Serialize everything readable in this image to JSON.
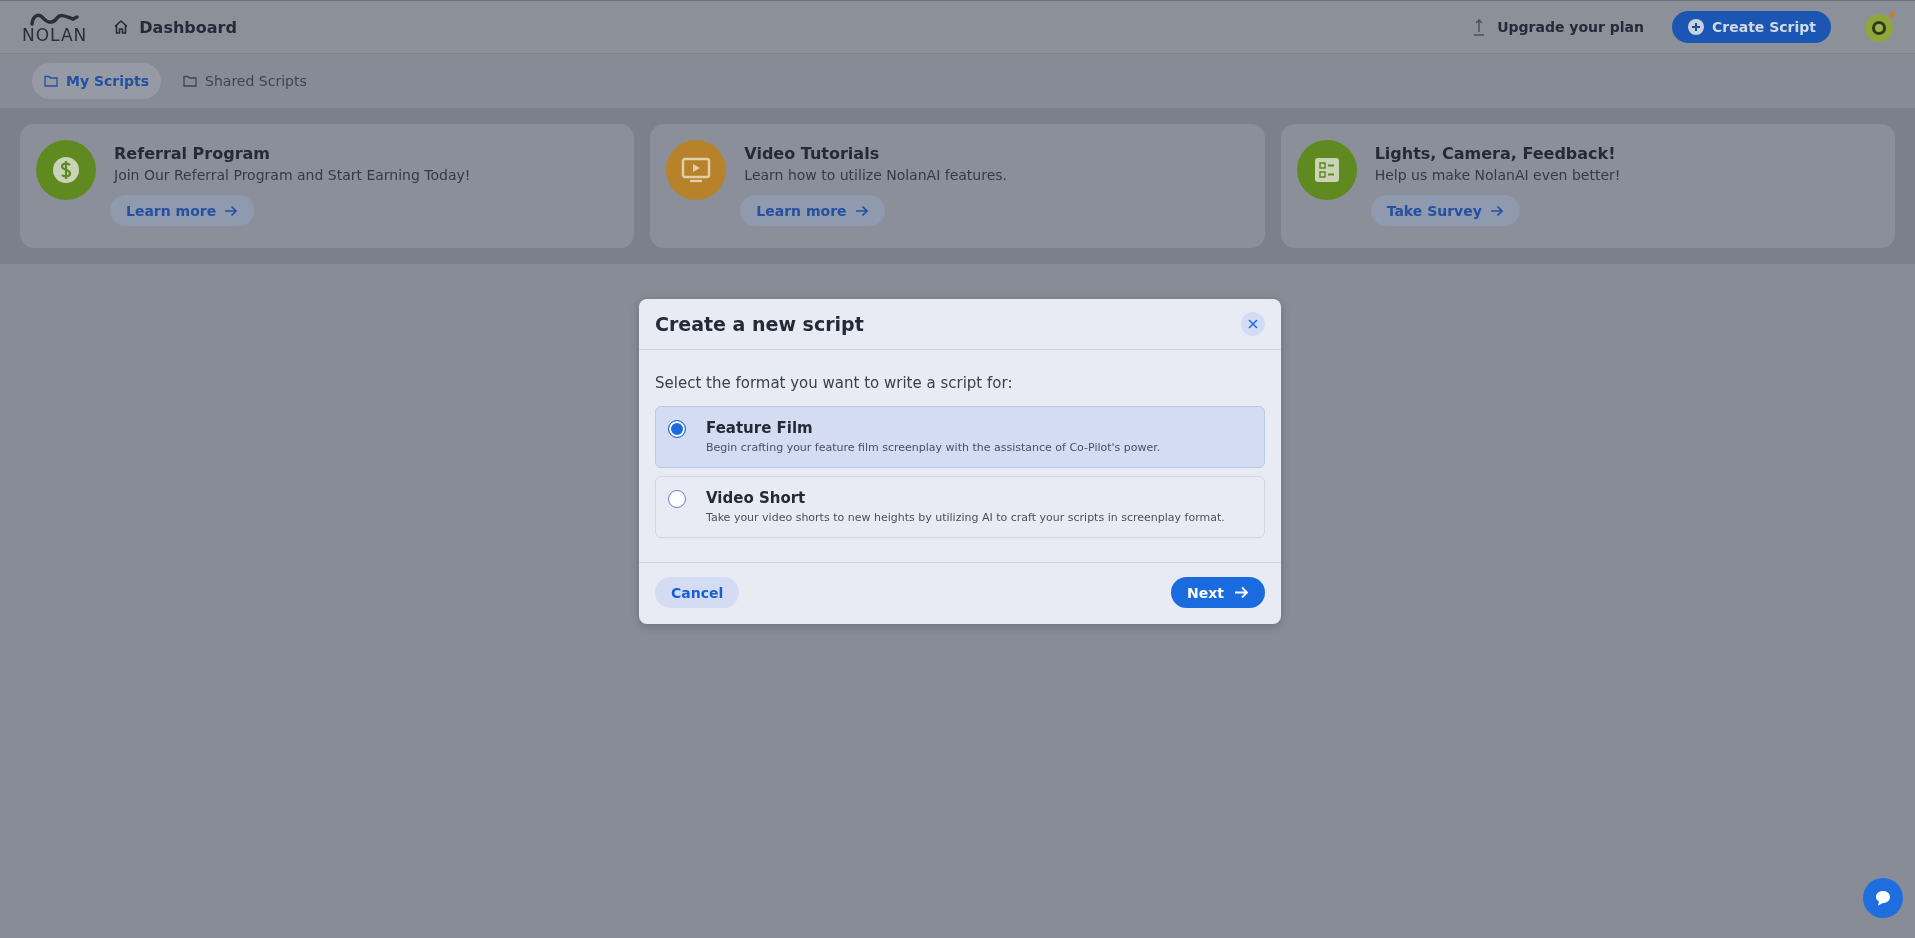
{
  "header": {
    "logo": "NOLAN",
    "breadcrumb": "Dashboard",
    "upgrade": "Upgrade your plan",
    "create_button": "Create Script"
  },
  "tabs": [
    {
      "label": "My Scripts",
      "selected": true
    },
    {
      "label": "Shared Scripts",
      "selected": false
    }
  ],
  "cards": [
    {
      "kind": "dollar",
      "color": "#5e8a1f",
      "title": "Referral Program",
      "text": "Join Our Referral Program and Start Earning Today!",
      "button": "Learn more"
    },
    {
      "kind": "video",
      "color": "#b7822a",
      "title": "Video Tutorials",
      "text": "Learn how to utilize NolanAI features.",
      "button": "Learn more"
    },
    {
      "kind": "checklist",
      "color": "#5e8a1f",
      "title": "Lights, Camera, Feedback!",
      "text": "Help us make NolanAI even better!",
      "button": "Take Survey"
    }
  ],
  "dialog": {
    "title": "Create a new script",
    "prompt": "Select the format you want to write a script for:",
    "options": [
      {
        "title": "Feature Film",
        "description": "Begin crafting your feature film screenplay with the assistance of Co-Pilot's power.",
        "selected": true
      },
      {
        "title": "Video Short",
        "description": "Take your video shorts to new heights by utilizing AI to craft your scripts in screenplay format.",
        "selected": false
      }
    ],
    "cancel": "Cancel",
    "next": "Next"
  }
}
